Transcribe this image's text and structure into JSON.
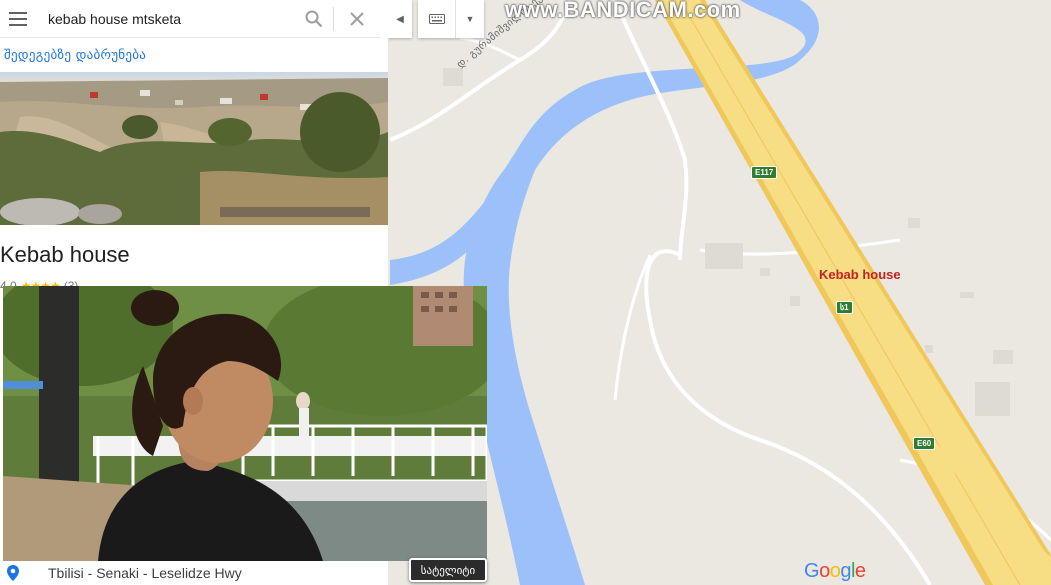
{
  "search": {
    "query": "kebab house mtsketa"
  },
  "panel": {
    "back_label": "შედეგებზე დაბრუნება",
    "title": "Kebab house",
    "rating": "4.0",
    "stars": "★★★★",
    "review_count": "(3)",
    "address": "Tbilisi - Senaki - Leselidze Hwy"
  },
  "map": {
    "place_label": "Kebab house",
    "street_label": "დ. გურამიშვილის ქუჩ.",
    "shields": {
      "e117": "E117",
      "s1": "ს1",
      "e60": "E60"
    },
    "satellite_label": "სატელიტი",
    "google_letters": [
      "G",
      "o",
      "o",
      "g",
      "l",
      "e"
    ],
    "google_colors": [
      "#4285f4",
      "#ea4335",
      "#fbbc04",
      "#4285f4",
      "#34a853",
      "#ea4335"
    ]
  },
  "watermark": "www.BANDICAM.com",
  "colors": {
    "water": "#9cc0f9",
    "highway": "#f7dd83",
    "land": "#ebe8e1",
    "pin": "#ea4335"
  }
}
